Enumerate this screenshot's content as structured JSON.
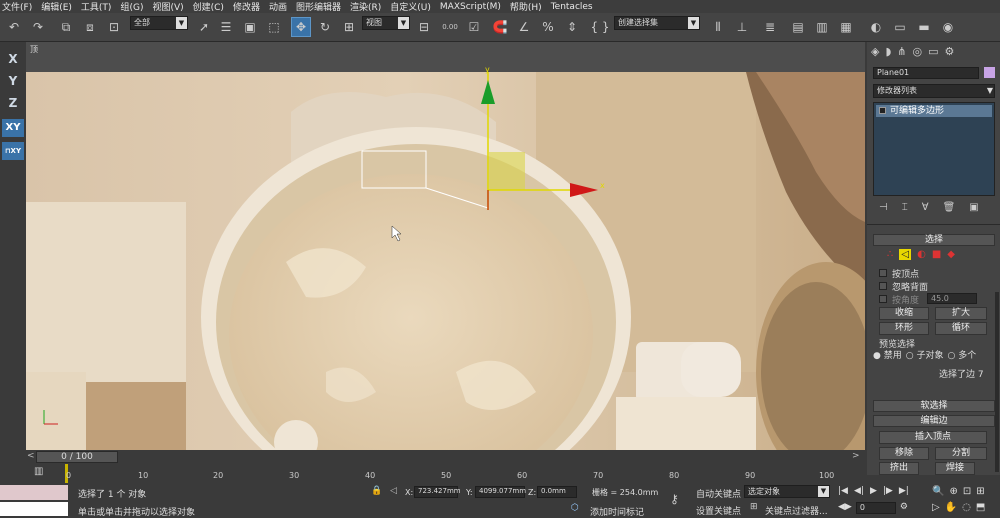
{
  "menu": [
    "文件(F)",
    "编辑(E)",
    "工具(T)",
    "组(G)",
    "视图(V)",
    "创建(C)",
    "修改器",
    "动画",
    "图形编辑器",
    "渲染(R)",
    "自定义(U)",
    "MAXScript(M)",
    "帮助(H)",
    "Tentacles"
  ],
  "toolbar": {
    "filter_value": "全部",
    "refcoord_value": "视图",
    "snap_value": "0.00",
    "named_selection_value": "创建选择集"
  },
  "left_axes": [
    "X",
    "Y",
    "Z",
    "XY",
    "XY"
  ],
  "viewport": {
    "label": "顶"
  },
  "right_panel": {
    "object_name": "Plane01",
    "object_color": "#c8a4e6",
    "modifier_list_label": "修改器列表",
    "stack_item": "可编辑多边形",
    "rollout_selection": "选择",
    "by_vertex": "按顶点",
    "ignore_backfacing": "忽略背面",
    "by_angle": "按角度",
    "angle_value": "45.0",
    "shrink": "收缩",
    "grow": "扩大",
    "ring": "环形",
    "loop": "循环",
    "preview_selection": "预览选择",
    "preview_disable": "禁用",
    "preview_subobject": "子对象",
    "preview_multi": "多个",
    "selected_edges": "选择了边 7",
    "rollout_soft": "软选择",
    "rollout_edit_edge": "编辑边",
    "insert_vertex": "插入顶点",
    "remove": "移除",
    "split": "分割",
    "extrude": "挤出",
    "weld": "焊接"
  },
  "timeline": {
    "frame_label": "0 / 100",
    "ticks": [
      "0",
      "10",
      "20",
      "30",
      "40",
      "50",
      "60",
      "70",
      "80",
      "90",
      "100"
    ]
  },
  "status": {
    "selected_text": "选择了 1 个 对象",
    "prompt_text": "单击或单击并拖动以选择对象",
    "x_label": "X:",
    "x_value": "723.427mm",
    "y_label": "Y:",
    "y_value": "4099.077mm",
    "z_label": "Z:",
    "z_value": "0.0mm",
    "grid_text": "栅格 = 254.0mm",
    "auto_key": "自动关键点",
    "set_key": "设置关键点",
    "key_mode_value": "选定对象",
    "key_filter": "关键点过滤器...",
    "add_time_tag": "添加时间标记",
    "frame_value": "0"
  }
}
